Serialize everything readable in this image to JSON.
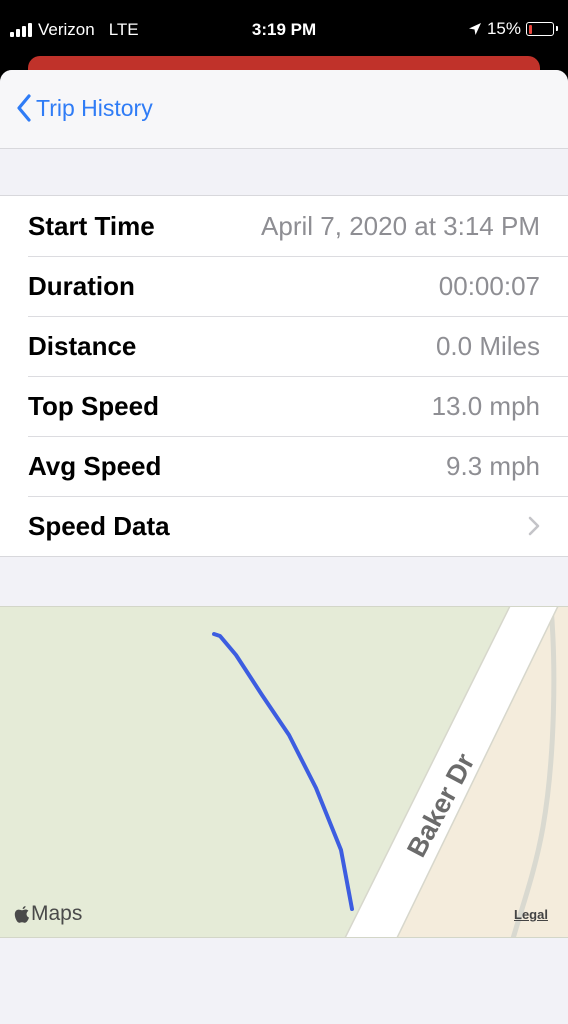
{
  "status_bar": {
    "carrier": "Verizon",
    "network": "LTE",
    "time": "3:19 PM",
    "battery": "15%",
    "battery_level": 0.15,
    "battery_color": "#e8453c",
    "location_icon": "location-arrow-icon"
  },
  "nav": {
    "back_label": "Trip History",
    "accent_color": "#2f7cf6"
  },
  "details": {
    "rows": [
      {
        "label": "Start Time",
        "value": "April 7, 2020 at 3:14 PM"
      },
      {
        "label": "Duration",
        "value": "00:00:07"
      },
      {
        "label": "Distance",
        "value": "0.0 Miles"
      },
      {
        "label": "Top Speed",
        "value": "13.0 mph"
      },
      {
        "label": "Avg Speed",
        "value": "9.3 mph"
      },
      {
        "label": "Speed Data"
      }
    ]
  },
  "map": {
    "road_name": "Baker Dr",
    "attribution": "Maps",
    "legal": "Legal",
    "route_color": "#3d5de0"
  }
}
